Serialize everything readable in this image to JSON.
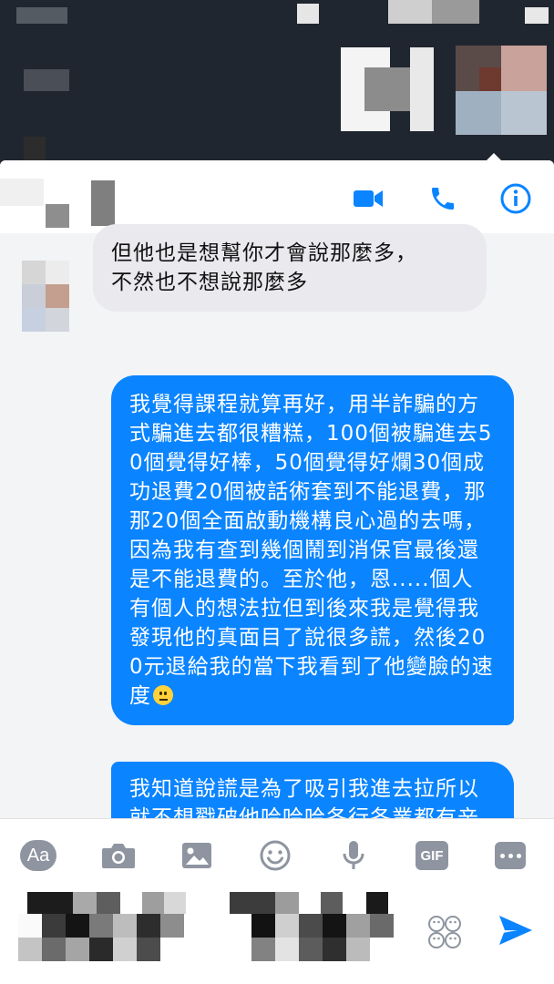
{
  "header": {
    "icons": [
      "video-call-icon",
      "phone-call-icon",
      "info-icon"
    ]
  },
  "colors": {
    "accent": "#0a84ff",
    "incoming_bubble": "#e9e9ee",
    "toolbar_icon": "#8e95a0"
  },
  "messages": [
    {
      "direction": "incoming",
      "text": "但他也是想幫你才會說那麼多，\n不然也不想說那麼多"
    },
    {
      "direction": "outgoing",
      "text": "我覺得課程就算再好，用半詐騙的方式騙進去都很糟糕，100個被騙進去50個覺得好棒，50個覺得好爛30個成功退費20個被話術套到不能退費，那那20個全面啟動機構良心過的去嗎，因為我有查到幾個鬧到消保官最後還是不能退費的。至於他，恩.....個人有個人的想法拉但到後來我是覺得我發現他的真面目了說很多謊，然後200元退給我的當下我看到了他變臉的速度",
      "trailing_emoji": "neutral-face-emoji"
    },
    {
      "direction": "outgoing",
      "text": "我知道說謊是為了吸引我進去拉所以就不想戳破他哈哈哈各行各業都有辛苦的地方"
    }
  ],
  "composer": {
    "aa_label": "Aa",
    "gif_label": "GIF",
    "tools": [
      "text-format-button",
      "camera-icon",
      "gallery-icon",
      "emoji-icon",
      "microphone-icon",
      "gif-button",
      "more-icon"
    ]
  }
}
